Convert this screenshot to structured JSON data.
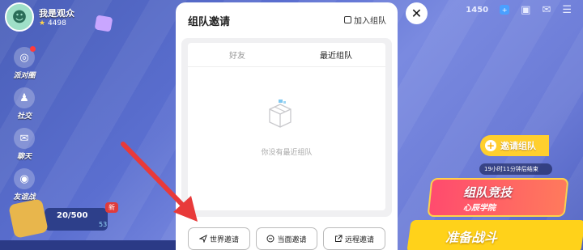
{
  "profile": {
    "name": "我是观众",
    "score": "4498"
  },
  "sidebar": {
    "items": [
      {
        "label": "派对圈",
        "icon": "party-icon"
      },
      {
        "label": "社交",
        "icon": "social-icon"
      },
      {
        "label": "聊天",
        "icon": "chat-icon"
      },
      {
        "label": "友谊战",
        "icon": "gamepad-icon"
      }
    ]
  },
  "level": {
    "progress": "20/500",
    "new_badge": "新",
    "sub": "53"
  },
  "topbar": {
    "currency": "1450"
  },
  "right_panel": {
    "invite_label": "邀请组队",
    "timer_text": "19小时11分钟后结束",
    "team_title": "组队竞技",
    "team_sub": "心辰学院",
    "ready_label": "准备战斗"
  },
  "dialog": {
    "title": "组队邀请",
    "join_label": "加入组队",
    "tabs": [
      {
        "label": "好友"
      },
      {
        "label": "最近组队"
      }
    ],
    "active_tab": "最近组队",
    "empty_text": "你没有最近组队",
    "buttons": [
      {
        "label": "世界邀请",
        "icon": "send-icon"
      },
      {
        "label": "当面邀请",
        "icon": "face-icon"
      },
      {
        "label": "远程邀请",
        "icon": "share-icon"
      }
    ]
  },
  "colors": {
    "accent_red": "#e83a3a",
    "yellow": "#ffd21a"
  }
}
